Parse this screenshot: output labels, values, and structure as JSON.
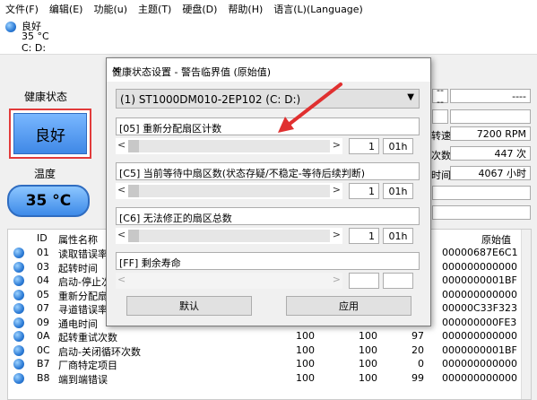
{
  "menu": [
    "文件(F)",
    "编辑(E)",
    "功能(u)",
    "主题(T)",
    "硬盘(D)",
    "帮助(H)",
    "语言(L)(Language)"
  ],
  "top_status": {
    "health": "良好",
    "temp": "35 °C",
    "drives": "C: D:"
  },
  "left_panel": {
    "health_label": "健康状态",
    "health_value": "良好",
    "temp_label": "温度",
    "temp_value": "35 °C"
  },
  "right_panel": {
    "rows": [
      {
        "label": "",
        "left_value": "----",
        "right_value": "----"
      },
      {
        "label": "转速",
        "value": "7200 RPM"
      },
      {
        "label": "次数",
        "value": "447 次"
      },
      {
        "label": "时间",
        "value": "4067 小时"
      }
    ]
  },
  "table": {
    "headers": {
      "id": "ID",
      "name": "属性名称",
      "raw": "原始值"
    },
    "rows": [
      {
        "id": "01",
        "name": "读取错误率",
        "cur": "",
        "worst": "",
        "thr": "",
        "raw": "00000687E6C1"
      },
      {
        "id": "03",
        "name": "起转时间",
        "cur": "",
        "worst": "",
        "thr": "",
        "raw": "000000000000"
      },
      {
        "id": "04",
        "name": "启动-停止次",
        "cur": "",
        "worst": "",
        "thr": "",
        "raw": "0000000001BF"
      },
      {
        "id": "05",
        "name": "重新分配扇区",
        "cur": "",
        "worst": "",
        "thr": "",
        "raw": "000000000000"
      },
      {
        "id": "07",
        "name": "寻道错误率",
        "cur": "",
        "worst": "",
        "thr": "",
        "raw": "00000C33F323"
      },
      {
        "id": "09",
        "name": "通电时间",
        "cur": "96",
        "worst": "96",
        "thr": "0",
        "raw": "000000000FE3"
      },
      {
        "id": "0A",
        "name": "起转重试次数",
        "cur": "100",
        "worst": "100",
        "thr": "97",
        "raw": "000000000000"
      },
      {
        "id": "0C",
        "name": "启动-关闭循环次数",
        "cur": "100",
        "worst": "100",
        "thr": "20",
        "raw": "0000000001BF"
      },
      {
        "id": "B7",
        "name": "厂商特定项目",
        "cur": "100",
        "worst": "100",
        "thr": "0",
        "raw": "000000000000"
      },
      {
        "id": "B8",
        "name": "端到端错误",
        "cur": "100",
        "worst": "100",
        "thr": "99",
        "raw": "000000000000"
      }
    ]
  },
  "dialog": {
    "title": "健康状态设置 - 警告临界值 (原始值)",
    "drive": "(1) ST1000DM010-2EP102  (C: D:)",
    "groups": [
      {
        "label": "[05] 重新分配扇区计数",
        "value": "1",
        "hex": "01h",
        "enabled": true
      },
      {
        "label": "[C5] 当前等待中扇区数(状态存疑/不稳定-等待后续判断)",
        "value": "1",
        "hex": "01h",
        "enabled": true
      },
      {
        "label": "[C6] 无法修正的扇区总数",
        "value": "1",
        "hex": "01h",
        "enabled": true
      },
      {
        "label": "[FF] 剩余寿命",
        "value": "",
        "hex": "",
        "enabled": false
      }
    ],
    "default_label": "默认",
    "apply_label": "应用"
  },
  "colors": {
    "accent_red": "#e23b3b",
    "health_blue": "#3f88e6",
    "arrow_red": "#e03030"
  }
}
